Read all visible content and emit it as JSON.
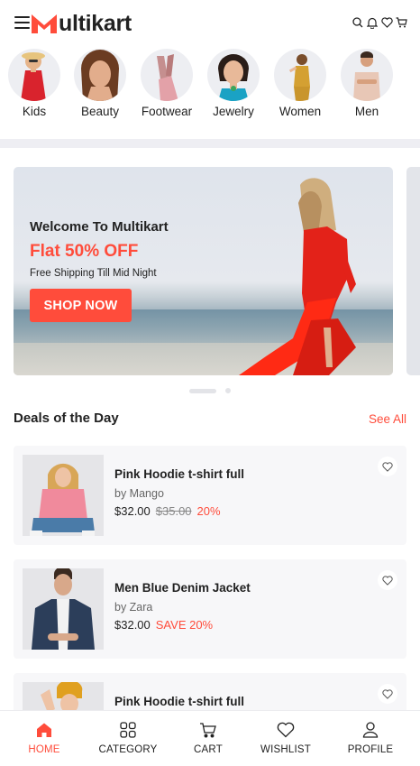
{
  "app": {
    "logo_text": "ultikart",
    "brand_color": "#ff4c3b"
  },
  "header": {
    "menu_icon": "hamburger-icon",
    "icons": [
      "search-icon",
      "bell-icon",
      "heart-icon",
      "cart-icon"
    ]
  },
  "categories": [
    {
      "label": "Kids"
    },
    {
      "label": "Beauty"
    },
    {
      "label": "Footwear"
    },
    {
      "label": "Jewelry"
    },
    {
      "label": "Women"
    },
    {
      "label": "Men"
    }
  ],
  "banner": {
    "welcome": "Welcome To Multikart",
    "offer": "Flat 50% OFF",
    "subtitle": "Free Shipping Till Mid Night",
    "button": "SHOP NOW"
  },
  "deals": {
    "title": "Deals of the Day",
    "see_all": "See All",
    "items": [
      {
        "name": "Pink Hoodie t-shirt full",
        "brand": "by Mango",
        "price": "$32.00",
        "old_price": "$35.00",
        "discount": "20%"
      },
      {
        "name": "Men Blue Denim Jacket",
        "brand": "by Zara",
        "price": "$32.00",
        "old_price": "",
        "discount": "SAVE 20%"
      },
      {
        "name": "Pink Hoodie t-shirt full",
        "brand": "",
        "price": "",
        "old_price": "",
        "discount": ""
      }
    ]
  },
  "bottom_nav": [
    {
      "label": "HOME",
      "icon": "home-icon",
      "active": true
    },
    {
      "label": "CATEGORY",
      "icon": "grid-icon",
      "active": false
    },
    {
      "label": "CART",
      "icon": "cart-icon",
      "active": false
    },
    {
      "label": "WISHLIST",
      "icon": "heart-icon",
      "active": false
    },
    {
      "label": "PROFILE",
      "icon": "user-icon",
      "active": false
    }
  ]
}
